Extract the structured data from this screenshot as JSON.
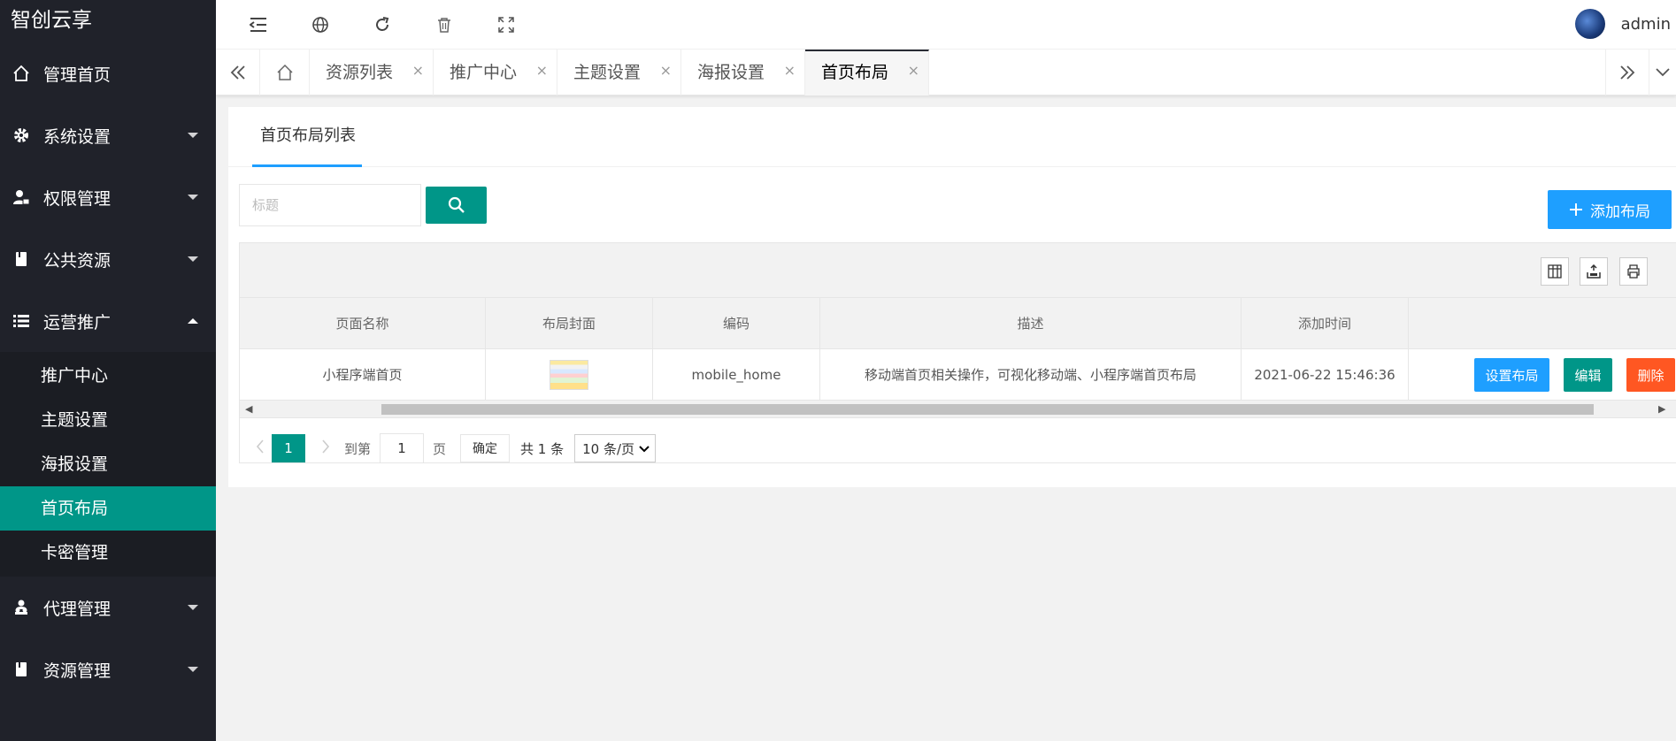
{
  "app": {
    "title": "智创云享"
  },
  "sidebar": {
    "items": [
      {
        "label": "管理首页",
        "icon": "home-icon"
      },
      {
        "label": "系统设置",
        "icon": "gear-icon"
      },
      {
        "label": "权限管理",
        "icon": "user-lock-icon"
      },
      {
        "label": "公共资源",
        "icon": "book-icon"
      },
      {
        "label": "运营推广",
        "icon": "list-icon",
        "expanded": true
      }
    ],
    "sub_items": [
      {
        "label": "推广中心"
      },
      {
        "label": "主题设置"
      },
      {
        "label": "海报设置"
      },
      {
        "label": "首页布局",
        "active": true
      },
      {
        "label": "卡密管理"
      }
    ],
    "bottom_items": [
      {
        "label": "代理管理",
        "icon": "users-icon"
      },
      {
        "label": "资源管理",
        "icon": "book-icon"
      }
    ]
  },
  "topbar": {
    "icons": [
      "menu-fold-icon",
      "globe-icon",
      "refresh-icon",
      "trash-icon",
      "fullscreen-icon"
    ],
    "user": {
      "name": "admin"
    }
  },
  "tabs": {
    "items": [
      {
        "label": "资源列表"
      },
      {
        "label": "推广中心"
      },
      {
        "label": "主题设置"
      },
      {
        "label": "海报设置"
      },
      {
        "label": "首页布局",
        "active": true
      }
    ],
    "close_glyph": "×"
  },
  "card": {
    "title": "首页布局列表"
  },
  "search": {
    "placeholder": "标题"
  },
  "add_button": {
    "label": "添加布局"
  },
  "table": {
    "columns": [
      "页面名称",
      "布局封面",
      "编码",
      "描述",
      "添加时间",
      ""
    ],
    "rows": [
      {
        "name": "小程序端首页",
        "code": "mobile_home",
        "description": "移动端首页相关操作，可视化移动端、小程序端首页布局",
        "added": "2021-06-22 15:46:36",
        "actions": {
          "layout": "设置布局",
          "edit": "编辑",
          "delete": "删除"
        }
      }
    ]
  },
  "pagination": {
    "current": "1",
    "goto_label": "到第",
    "goto_value": "1",
    "page_label": "页",
    "confirm": "确定",
    "total": "共 1 条",
    "page_size": "10 条/页"
  },
  "colors": {
    "sidebar_bg": "#20222a",
    "accent": "#009688",
    "blue": "#1e9fff",
    "danger": "#ff5722"
  }
}
